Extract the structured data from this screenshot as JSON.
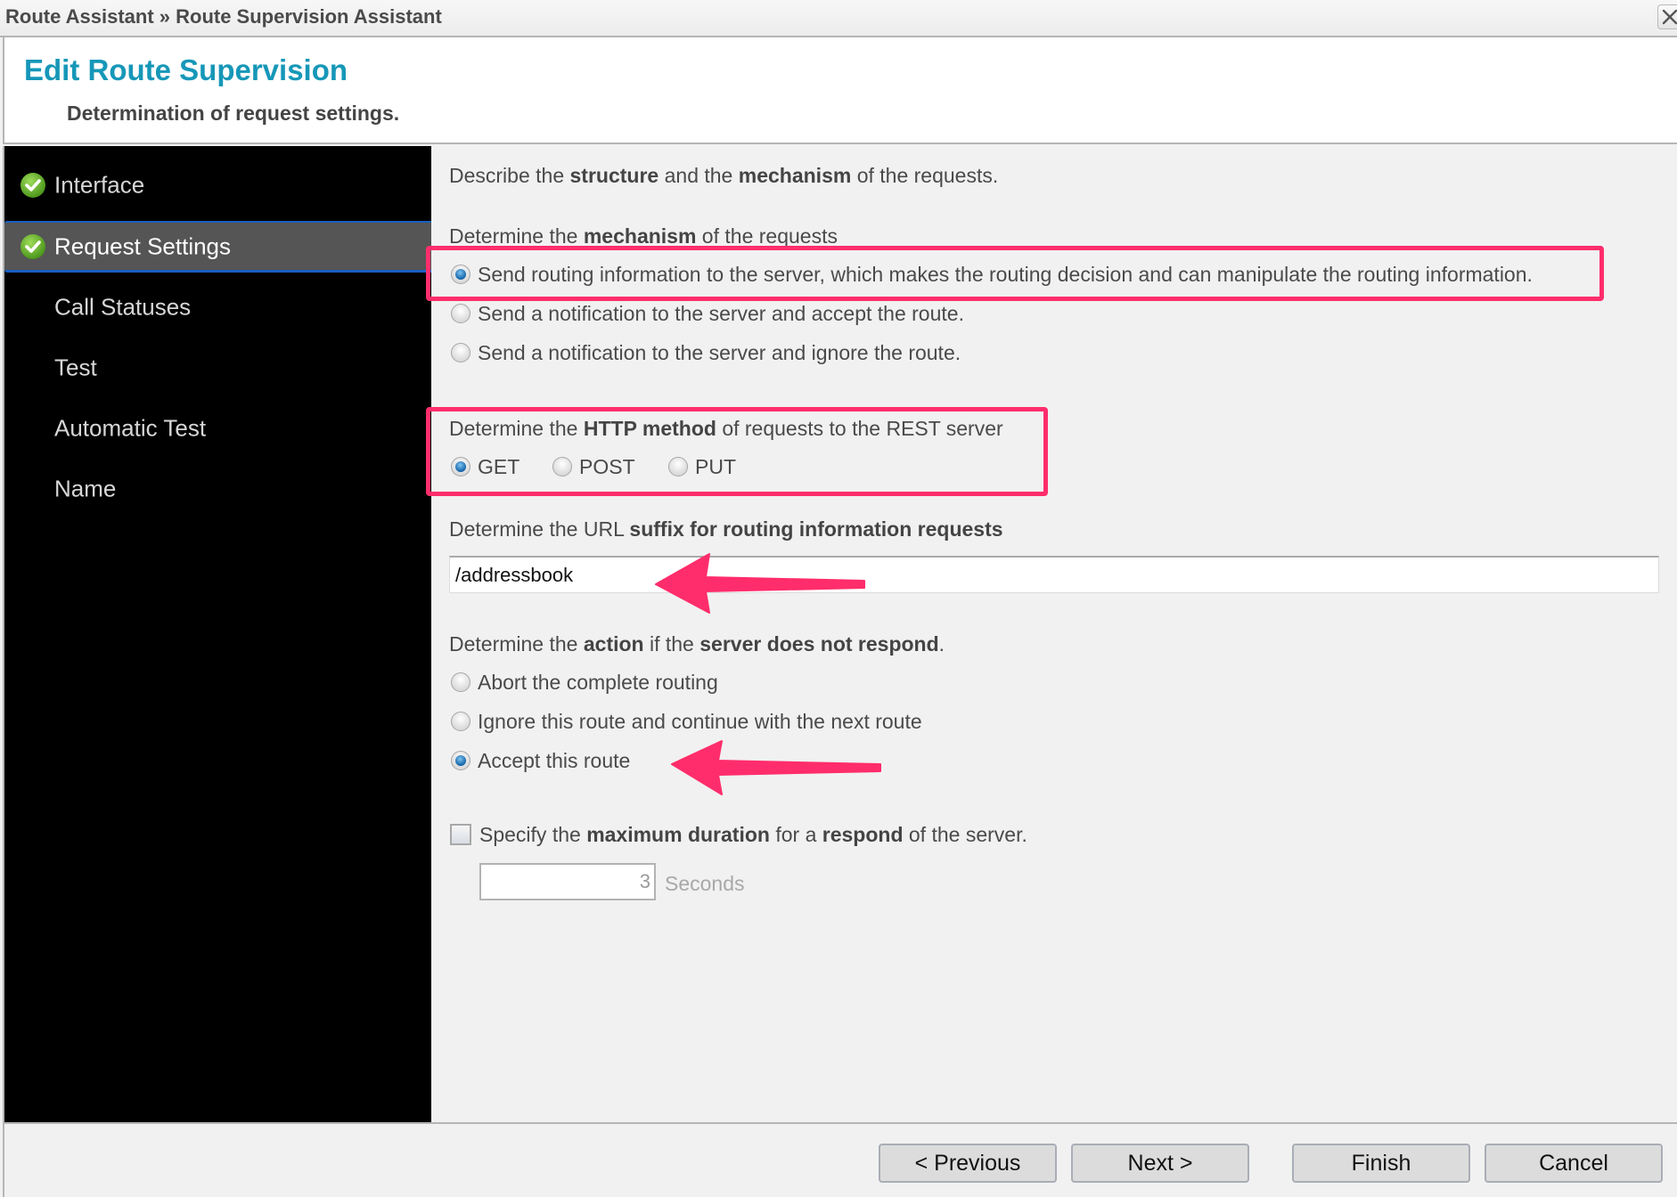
{
  "window": {
    "breadcrumb": "Route Assistant » Route Supervision Assistant",
    "close_icon": "close-icon"
  },
  "header": {
    "title": "Edit Route Supervision",
    "subtitle": "Determination of request settings."
  },
  "sidebar": {
    "items": [
      {
        "label": "Interface",
        "completed": true,
        "active": false
      },
      {
        "label": "Request Settings",
        "completed": true,
        "active": true
      },
      {
        "label": "Call Statuses",
        "completed": false,
        "active": false
      },
      {
        "label": "Test",
        "completed": false,
        "active": false
      },
      {
        "label": "Automatic Test",
        "completed": false,
        "active": false
      },
      {
        "label": "Name",
        "completed": false,
        "active": false
      }
    ]
  },
  "content": {
    "intro": {
      "p1": "Describe the ",
      "b1": "structure",
      "p2": " and the ",
      "b2": "mechanism",
      "p3": " of the requests."
    },
    "mechanism": {
      "label": {
        "p1": "Determine the ",
        "b1": "mechanism",
        "p2": " of the requests"
      },
      "options": [
        {
          "label": "Send routing information to the server, which makes the routing decision and can manipulate the routing information.",
          "selected": true
        },
        {
          "label": "Send a notification to the server and accept the route.",
          "selected": false
        },
        {
          "label": "Send a notification to the server and ignore the route.",
          "selected": false
        }
      ]
    },
    "http_method": {
      "label": {
        "p1": "Determine the ",
        "b1": "HTTP method",
        "p2": " of requests to the REST server"
      },
      "options": [
        {
          "label": "GET",
          "selected": true
        },
        {
          "label": "POST",
          "selected": false
        },
        {
          "label": "PUT",
          "selected": false
        }
      ]
    },
    "url_suffix": {
      "label": {
        "p1": "Determine the URL ",
        "b1": "suffix for routing information requests"
      },
      "value": "/addressbook"
    },
    "no_response": {
      "label": {
        "p1": "Determine the ",
        "b1": "action",
        "p2": " if the ",
        "b2": "server does not respond",
        "p3": "."
      },
      "options": [
        {
          "label": "Abort the complete routing",
          "selected": false
        },
        {
          "label": "Ignore this route and continue with the next route",
          "selected": false
        },
        {
          "label": "Accept this route",
          "selected": true
        }
      ]
    },
    "max_duration": {
      "checked": false,
      "label": {
        "p1": "Specify the ",
        "b1": "maximum duration",
        "p2": " for a ",
        "b2": "respond",
        "p3": " of the server."
      },
      "value": "3",
      "unit": "Seconds"
    }
  },
  "footer": {
    "previous": "< Previous",
    "next": "Next >",
    "finish": "Finish",
    "cancel": "Cancel"
  },
  "annotations": {
    "highlight_color": "#ff2d6b"
  }
}
